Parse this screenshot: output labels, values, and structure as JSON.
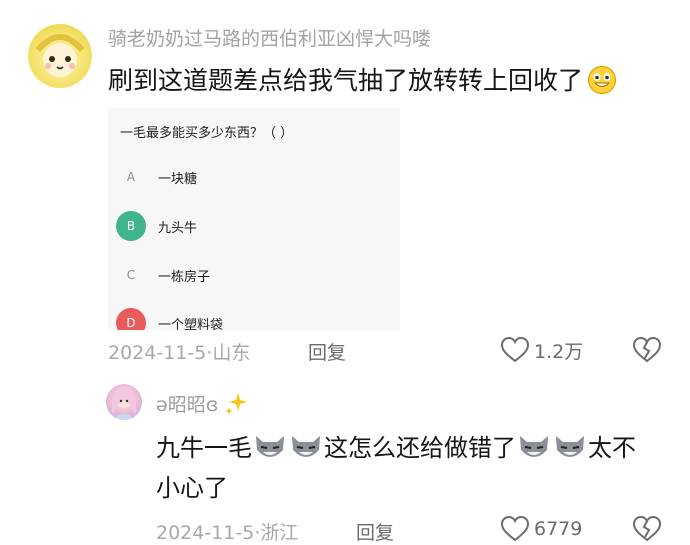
{
  "main_comment": {
    "author": "骑老奶奶过马路的西伯利亚凶悍大吗喽",
    "text": "刷到这道题差点给我气抽了放转转上回收了",
    "date": "2024-11-5",
    "location": "山东",
    "reply_label": "回复",
    "likes": "1.2万"
  },
  "quiz": {
    "question": "一毛最多能买多少东西？（  ）",
    "options": [
      {
        "letter": "A",
        "text": "一块糖"
      },
      {
        "letter": "B",
        "text": "九头牛"
      },
      {
        "letter": "C",
        "text": "一栋房子"
      },
      {
        "letter": "D",
        "text": "一个塑料袋"
      }
    ],
    "colors": {
      "selected_b": "#3fb58b",
      "selected_d": "#ea5a5a"
    }
  },
  "reply": {
    "author": "ə昭昭ɞ",
    "text_1": "九牛一毛",
    "text_2": "这怎么还给做错了",
    "text_3": "太不小心了",
    "date": "2024-11-5",
    "location": "浙江",
    "reply_label": "回复",
    "likes": "6779"
  },
  "icons": [
    "heart-outline-icon",
    "broken-heart-icon",
    "grinning-emoji-icon",
    "wolf-emoji-icon",
    "sparkles-icon"
  ]
}
